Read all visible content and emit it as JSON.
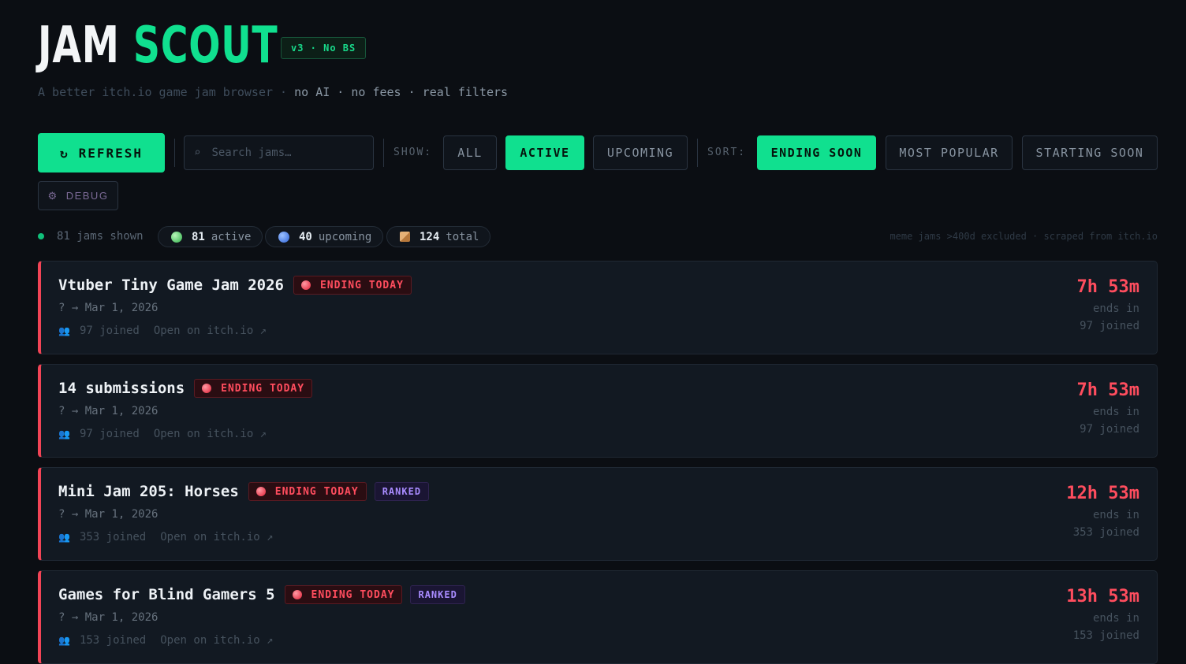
{
  "header": {
    "title_part1": "JAM",
    "title_part2": "SCOUT",
    "version_badge": "v3 · No BS",
    "subtitle_dim": "A better itch.io game jam browser ·",
    "subtitle_hi": "no AI · no fees · real filters",
    "accent_color": "#10e08f"
  },
  "toolbar": {
    "refresh_icon": "↻",
    "refresh_label": "REFRESH",
    "search_icon": "⌕",
    "search_placeholder": "Search jams…",
    "show_label": "SHOW:",
    "show_options": [
      "ALL",
      "ACTIVE",
      "UPCOMING"
    ],
    "show_selected": "ACTIVE",
    "sort_label": "SORT:",
    "sort_options": [
      "ENDING SOON",
      "MOST POPULAR",
      "STARTING SOON"
    ],
    "sort_selected": "ENDING SOON",
    "debug_icon": "⚙",
    "debug_label": "DEBUG"
  },
  "stats": {
    "shown": "81 jams shown",
    "active_count": "81",
    "active_label": "active",
    "upcoming_count": "40",
    "upcoming_label": "upcoming",
    "total_count": "124",
    "total_label": "total",
    "note": "meme jams >400d excluded · scraped from itch.io"
  },
  "jams": [
    {
      "name": "Vtuber Tiny Game Jam 2026",
      "status": "ENDING TODAY",
      "ranked": null,
      "dates": "? → Mar 1, 2026",
      "joined": "97 joined",
      "link": "Open on itch.io ↗",
      "countdown": "7h 53m",
      "ends_in": "ends in",
      "joined_right": "97 joined"
    },
    {
      "name": "14 submissions",
      "status": "ENDING TODAY",
      "ranked": null,
      "dates": "? → Mar 1, 2026",
      "joined": "97 joined",
      "link": "Open on itch.io ↗",
      "countdown": "7h 53m",
      "ends_in": "ends in",
      "joined_right": "97 joined"
    },
    {
      "name": "Mini Jam 205: Horses",
      "status": "ENDING TODAY",
      "ranked": "RANKED",
      "dates": "? → Mar 1, 2026",
      "joined": "353 joined",
      "link": "Open on itch.io ↗",
      "countdown": "12h 53m",
      "ends_in": "ends in",
      "joined_right": "353 joined"
    },
    {
      "name": "Games for Blind Gamers 5",
      "status": "ENDING TODAY",
      "ranked": "RANKED",
      "dates": "? → Mar 1, 2026",
      "joined": "153 joined",
      "link": "Open on itch.io ↗",
      "countdown": "13h 53m",
      "ends_in": "ends in",
      "joined_right": "153 joined"
    }
  ]
}
